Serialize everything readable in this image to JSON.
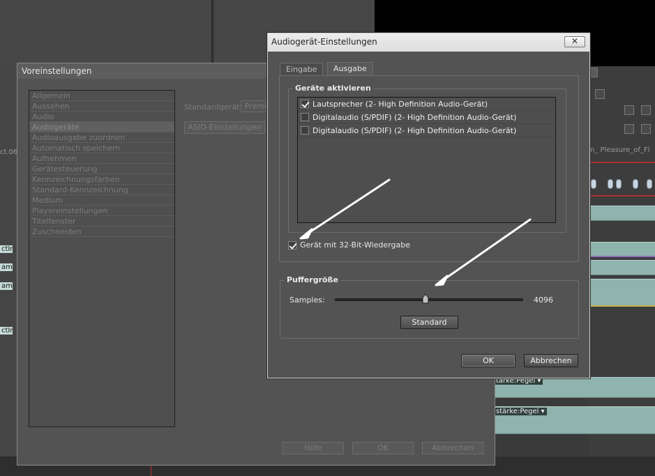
{
  "background": {
    "timeline_labels": [
      "ctInl",
      "ame",
      "ame",
      "ctInl",
      "n_ Pleasure_of_Fl",
      "ct.06"
    ],
    "pegel_1": "tärke:Pegel ▾",
    "pegel_2": "stärke:Pegel ▾"
  },
  "prefs_dialog": {
    "title": "Voreinstellungen",
    "categories": [
      "Allgemein",
      "Aussehen",
      "Audio",
      "Audiogeräte",
      "Audioausgabe zuordnen",
      "Automatisch speichern",
      "Aufnehmen",
      "Gerätesteuerung",
      "Kennzeichnungsfarben",
      "Standard-Kennzeichnung",
      "Medium",
      "Playereinstellungen",
      "Titelfenster",
      "Zuschneiden"
    ],
    "selected_category": "Audiogeräte",
    "standard_device_label": "Standardgerät:",
    "standard_device_value": "Premi",
    "asio_button": "ASIO-Einstellungen",
    "help_button": "Hilfe",
    "ok_button": "OK",
    "cancel_button": "Abbrechen"
  },
  "audio_dialog": {
    "title": "Audiogerät-Einstellungen",
    "close_glyph": "✕",
    "tabs": [
      {
        "label": "Eingabe",
        "active": false
      },
      {
        "label": "Ausgabe",
        "active": true
      }
    ],
    "devices_group_title": "Geräte aktivieren",
    "devices": [
      {
        "label": "Lautsprecher (2- High Definition Audio-Gerät)",
        "checked": true
      },
      {
        "label": "Digitalaudio (S/PDIF) (2- High Definition Audio-Gerät)",
        "checked": false
      },
      {
        "label": "Digitalaudio (S/PDIF) (2- High Definition Audio-Gerät)",
        "checked": false
      }
    ],
    "bit32_label": "Gerät mit 32-Bit-Wiedergabe",
    "bit32_checked": true,
    "buffer_group_title": "Puffergröße",
    "samples_label": "Samples:",
    "samples_value": "4096",
    "standard_button": "Standard",
    "ok_button": "OK",
    "cancel_button": "Abbrechen"
  },
  "colors": {
    "dialog_bg": "#535353",
    "timeline_track": "#8fb3ad",
    "annotation_arrow": "#ffffff"
  }
}
